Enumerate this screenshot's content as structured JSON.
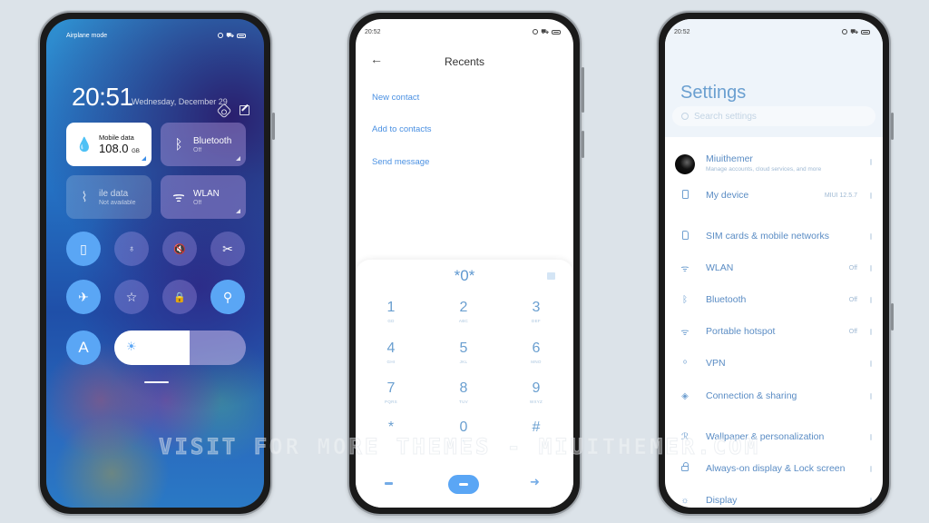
{
  "watermark": "VISIT FOR MORE THEMES - MIUITHEMER.COM",
  "phone1": {
    "status_left": "Airplane mode",
    "status_icons": [
      "alarm-icon",
      "cart-icon",
      "battery-icon"
    ],
    "time": "20:51",
    "date": "Wednesday, December 29",
    "tiles": {
      "mobile_data": {
        "title": "Mobile data",
        "value": "108.0",
        "unit": "GB",
        "icon": "water-drop-icon"
      },
      "bluetooth": {
        "title": "Bluetooth",
        "status": "Off",
        "icon": "bluetooth-icon"
      },
      "mobile_data_2": {
        "title": "ile data",
        "status": "Not available",
        "icon": "signal-icon"
      },
      "wlan": {
        "title": "WLAN",
        "status": "Off",
        "icon": "wifi-icon"
      }
    },
    "toggles": [
      {
        "name": "vibrate",
        "glyph": "▯",
        "on": true
      },
      {
        "name": "flashlight",
        "glyph": "♁",
        "on": false
      },
      {
        "name": "mute",
        "glyph": "🔇",
        "on": false
      },
      {
        "name": "screenshot",
        "glyph": "✂",
        "on": false
      },
      {
        "name": "airplane",
        "glyph": "✈",
        "on": true
      },
      {
        "name": "favorite",
        "glyph": "☆",
        "on": false
      },
      {
        "name": "lock",
        "glyph": "🔒",
        "on": false
      },
      {
        "name": "location",
        "glyph": "⚲",
        "on": true
      }
    ],
    "auto_brightness_glyph": "A",
    "brightness_level": 0.57,
    "sun_glyph": "☀"
  },
  "phone2": {
    "status_time": "20:52",
    "title": "Recents",
    "back_glyph": "←",
    "links": [
      "New contact",
      "Add to contacts",
      "Send message"
    ],
    "input": "*0*",
    "keys": [
      {
        "num": "1",
        "letters": "GD"
      },
      {
        "num": "2",
        "letters": "ABC"
      },
      {
        "num": "3",
        "letters": "DEF"
      },
      {
        "num": "4",
        "letters": "GHI"
      },
      {
        "num": "5",
        "letters": "JKL"
      },
      {
        "num": "6",
        "letters": "MNO"
      },
      {
        "num": "7",
        "letters": "PQRS"
      },
      {
        "num": "8",
        "letters": "TUV"
      },
      {
        "num": "9",
        "letters": "WXYZ"
      },
      {
        "num": "*",
        "letters": ""
      },
      {
        "num": "0",
        "letters": "+"
      },
      {
        "num": "#",
        "letters": ""
      }
    ],
    "forward_glyph": "➜"
  },
  "phone3": {
    "status_time": "20:52",
    "title": "Settings",
    "search_placeholder": "Search settings",
    "account": {
      "name": "Miuithemer",
      "subtitle": "Manage accounts, cloud services, and more"
    },
    "items": [
      {
        "label": "My device",
        "value": "MIUI 12.5.7",
        "icon": "phone-icon"
      },
      {
        "label": "SIM cards & mobile networks",
        "value": "",
        "icon": "sim-card-icon"
      },
      {
        "label": "WLAN",
        "value": "Off",
        "icon": "wifi-icon",
        "glyph": "ᯤ"
      },
      {
        "label": "Bluetooth",
        "value": "Off",
        "icon": "bluetooth-icon",
        "glyph": "ᛒ"
      },
      {
        "label": "Portable hotspot",
        "value": "Off",
        "icon": "hotspot-icon",
        "glyph": "ᯤ"
      },
      {
        "label": "VPN",
        "value": "",
        "icon": "vpn-icon",
        "glyph": "ᵒ"
      },
      {
        "label": "Connection & sharing",
        "value": "",
        "icon": "connection-icon",
        "glyph": "◈"
      },
      {
        "label": "Wallpaper & personalization",
        "value": "",
        "icon": "wallpaper-icon",
        "glyph": "ℛ"
      },
      {
        "label": "Always-on display & Lock screen",
        "value": "",
        "icon": "lock-icon"
      },
      {
        "label": "Display",
        "value": "",
        "icon": "display-icon",
        "glyph": "☼"
      }
    ]
  }
}
